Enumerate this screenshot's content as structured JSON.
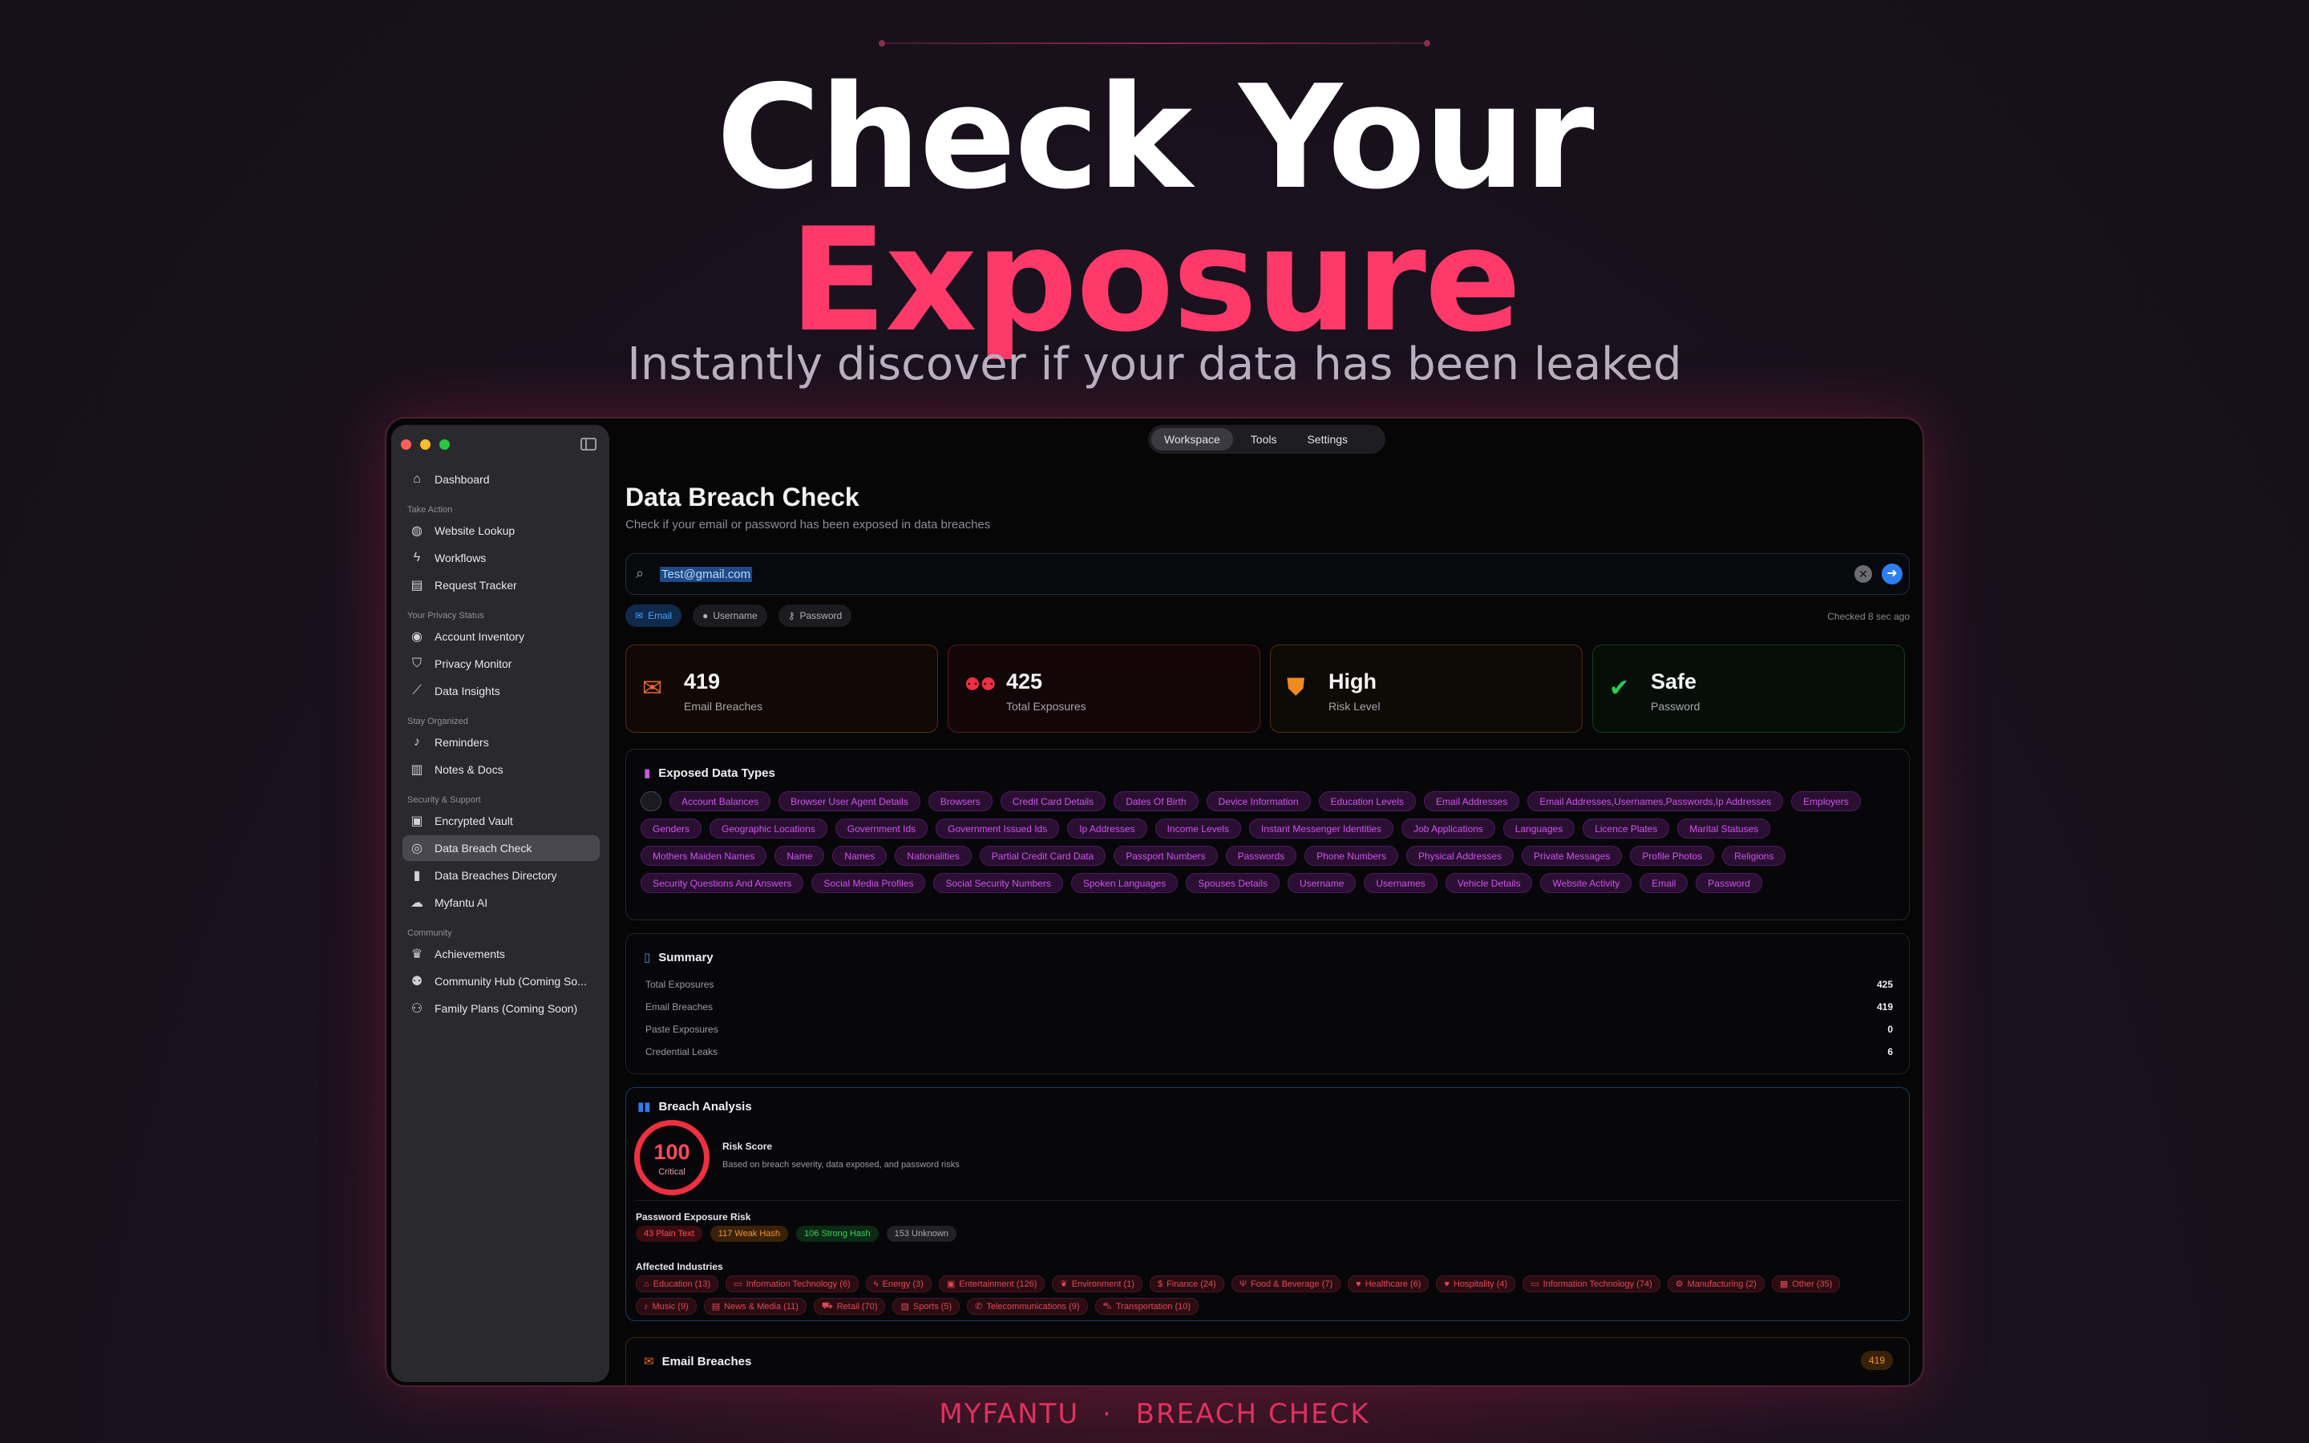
{
  "hero": {
    "line1": "Check Your",
    "line2": "Exposure",
    "subtitle": "Instantly discover if your data has been leaked"
  },
  "footer": {
    "left": "MYFANTU",
    "sep": "·",
    "right": "BREACH CHECK"
  },
  "colors": {
    "accent": "#ff3a6a",
    "purple_tag": "#cf55e8",
    "critical": "#ee3040",
    "link_blue": "#2b7ef0"
  },
  "sidebar": {
    "items": [
      {
        "label": "Dashboard",
        "icon": "house-icon"
      },
      {
        "section": "Take Action"
      },
      {
        "label": "Website Lookup",
        "icon": "globe-icon"
      },
      {
        "label": "Workflows",
        "icon": "bolt-icon"
      },
      {
        "label": "Request Tracker",
        "icon": "document-icon"
      },
      {
        "section": "Your Privacy Status"
      },
      {
        "label": "Account Inventory",
        "icon": "person-circle-icon"
      },
      {
        "label": "Privacy Monitor",
        "icon": "shield-icon"
      },
      {
        "label": "Data Insights",
        "icon": "chart-line-icon"
      },
      {
        "section": "Stay Organized"
      },
      {
        "label": "Reminders",
        "icon": "bell-icon"
      },
      {
        "label": "Notes & Docs",
        "icon": "book-icon"
      },
      {
        "section": "Security & Support"
      },
      {
        "label": "Encrypted Vault",
        "icon": "lock-icon"
      },
      {
        "label": "Data Breach Check",
        "icon": "breach-icon",
        "active": true
      },
      {
        "label": "Data Breaches Directory",
        "icon": "book-closed-icon"
      },
      {
        "label": "Myfantu AI",
        "icon": "chat-icon"
      },
      {
        "section": "Community"
      },
      {
        "label": "Achievements",
        "icon": "trophy-icon"
      },
      {
        "label": "Community Hub (Coming So...",
        "icon": "people-icon"
      },
      {
        "label": "Family Plans (Coming Soon)",
        "icon": "family-icon"
      }
    ]
  },
  "toolbar": {
    "tabs": [
      "Workspace",
      "Tools",
      "Settings"
    ],
    "active_tab": "Workspace"
  },
  "page": {
    "title": "Data Breach Check",
    "subtitle": "Check if your email or password has been exposed in data breaches"
  },
  "search": {
    "value": "Test@gmail.com"
  },
  "modes": [
    "Email",
    "Username",
    "Password"
  ],
  "checked": "Checked 8 sec ago",
  "stats": [
    {
      "value": "419",
      "label": "Email Breaches",
      "icon": "envelope-icon",
      "color": "#e86a2a",
      "border": "#5a2a14",
      "bg": "#120806"
    },
    {
      "value": "425",
      "label": "Total Exposures",
      "icon": "people-icon",
      "color": "#ee3040",
      "border": "#5a1a20",
      "bg": "#120608"
    },
    {
      "value": "High",
      "label": "Risk Level",
      "icon": "warning-shield-icon",
      "color": "#f08a20",
      "border": "#4a3018",
      "bg": "#0e0a06"
    },
    {
      "value": "Safe",
      "label": "Password",
      "icon": "check-shield-icon",
      "color": "#2ecc5a",
      "border": "#1a3a22",
      "bg": "#060e08"
    }
  ],
  "exposed": {
    "title": "Exposed Data Types",
    "tags": [
      "",
      "Account Balances",
      "Browser User Agent Details",
      "Browsers",
      "Credit Card Details",
      "Dates Of Birth",
      "Device Information",
      "Education Levels",
      "Email Addresses",
      "Email Addresses,Usernames,Passwords,Ip Addresses",
      "Employers",
      "Genders",
      "Geographic Locations",
      "Government Ids",
      "Government Issued Ids",
      "Ip Addresses",
      "Income Levels",
      "Instant Messenger Identities",
      "Job Applications",
      "Languages",
      "Licence Plates",
      "Marital Statuses",
      "Mothers Maiden Names",
      "Name",
      "Names",
      "Nationalities",
      "Partial Credit Card Data",
      "Passport Numbers",
      "Passwords",
      "Phone Numbers",
      "Physical Addresses",
      "Private Messages",
      "Profile Photos",
      "Religions",
      "Security Questions And Answers",
      "Social Media Profiles",
      "Social Security Numbers",
      "Spoken Languages",
      "Spouses Details",
      "Username",
      "Usernames",
      "Vehicle Details",
      "Website Activity",
      "Email",
      "Password"
    ]
  },
  "summary": {
    "title": "Summary",
    "rows": [
      {
        "label": "Total Exposures",
        "value": "425"
      },
      {
        "label": "Email Breaches",
        "value": "419"
      },
      {
        "label": "Paste Exposures",
        "value": "0"
      },
      {
        "label": "Credential Leaks",
        "value": "6"
      }
    ]
  },
  "analysis": {
    "title": "Breach Analysis",
    "score": "100",
    "score_label": "Critical",
    "risk_title": "Risk Score",
    "risk_desc": "Based on breach severity, data exposed, and password risks",
    "pw_title": "Password Exposure Risk",
    "pw_badges": [
      {
        "text": "43 Plain Text",
        "fg": "#ff4a56",
        "bg": "#3a0c12"
      },
      {
        "text": "117 Weak Hash",
        "fg": "#f0962a",
        "bg": "#3a220a"
      },
      {
        "text": "106 Strong Hash",
        "fg": "#38d060",
        "bg": "#0c2a14"
      },
      {
        "text": "153 Unknown",
        "fg": "#a8a8b0",
        "bg": "#222226"
      }
    ],
    "ind_title": "Affected Industries",
    "industries": [
      {
        "text": "Education (13)",
        "icon": "education-icon",
        "glyph": "⌂"
      },
      {
        "text": "Information Technology (6)",
        "icon": "monitor-icon",
        "glyph": "▭"
      },
      {
        "text": "Energy (3)",
        "icon": "bolt-icon",
        "glyph": "ϟ"
      },
      {
        "text": "Entertainment (126)",
        "icon": "film-icon",
        "glyph": "▣"
      },
      {
        "text": "Environment (1)",
        "icon": "leaf-icon",
        "glyph": "❦"
      },
      {
        "text": "Finance (24)",
        "icon": "dollar-icon",
        "glyph": "$"
      },
      {
        "text": "Food & Beverage (7)",
        "icon": "fork-icon",
        "glyph": "Ψ"
      },
      {
        "text": "Healthcare (6)",
        "icon": "heart-icon",
        "glyph": "♥"
      },
      {
        "text": "Hospitality (4)",
        "icon": "heart-icon",
        "glyph": "♥"
      },
      {
        "text": "Information Technology (74)",
        "icon": "monitor-icon",
        "glyph": "▭"
      },
      {
        "text": "Manufacturing (2)",
        "icon": "gear-icon",
        "glyph": "⚙"
      },
      {
        "text": "Other (35)",
        "icon": "grid-icon",
        "glyph": "▦"
      },
      {
        "text": "Music (9)",
        "icon": "music-icon",
        "glyph": "♪"
      },
      {
        "text": "News & Media (11)",
        "icon": "newspaper-icon",
        "glyph": "▤"
      },
      {
        "text": "Retail (70)",
        "icon": "cart-icon",
        "glyph": "⛟"
      },
      {
        "text": "Sports (5)",
        "icon": "sports-icon",
        "glyph": "▧"
      },
      {
        "text": "Telecommunications (9)",
        "icon": "phone-icon",
        "glyph": "✆"
      },
      {
        "text": "Transportation (10)",
        "icon": "car-icon",
        "glyph": "⛍"
      }
    ]
  },
  "email_breaches": {
    "title": "Email Breaches",
    "count": "419"
  }
}
